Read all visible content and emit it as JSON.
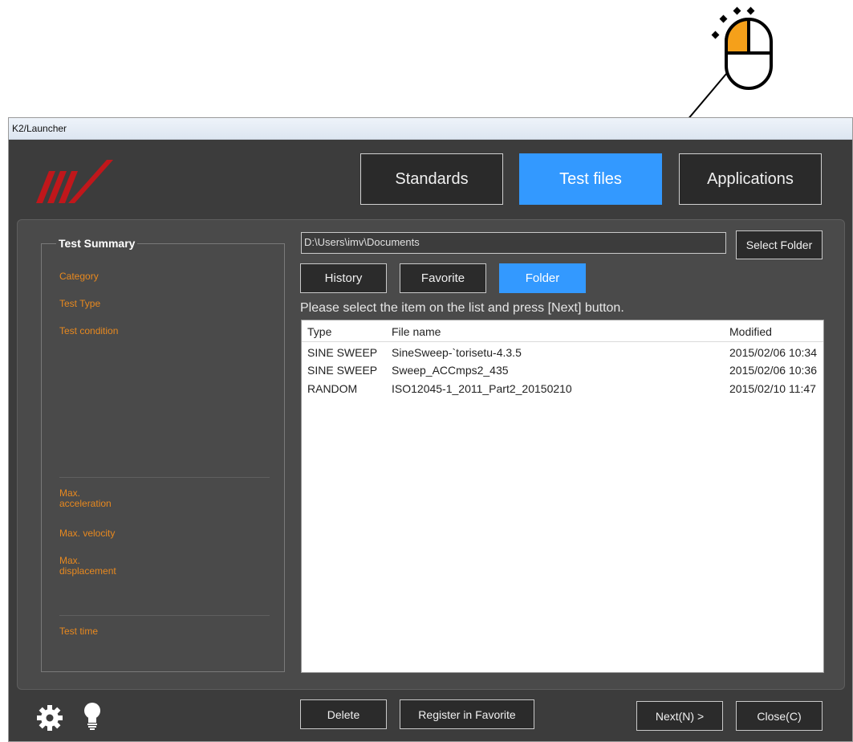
{
  "window": {
    "title": "K2/Launcher"
  },
  "top_tabs": [
    {
      "label": "Standards",
      "active": false
    },
    {
      "label": "Test files",
      "active": true
    },
    {
      "label": "Applications",
      "active": false
    }
  ],
  "summary": {
    "title": "Test Summary",
    "labels": {
      "category": "Category",
      "test_type": "Test Type",
      "test_condition": "Test condition",
      "max_acceleration": "Max.\nacceleration",
      "max_velocity": "Max. velocity",
      "max_displacement": "Max.\ndisplacement",
      "test_time": "Test time"
    }
  },
  "path": {
    "value": "D:\\Users\\imv\\Documents"
  },
  "select_folder_label": "Select Folder",
  "sub_tabs": [
    {
      "label": "History",
      "active": false
    },
    {
      "label": "Favorite",
      "active": false
    },
    {
      "label": "Folder",
      "active": true
    }
  ],
  "instruction": "Please select the item on the list and press [Next] button.",
  "file_list": {
    "columns": [
      "Type",
      "File name",
      "Modified"
    ],
    "rows": [
      [
        "SINE SWEEP",
        "SineSweep-`torisetu-4.3.5",
        "2015/02/06 10:34"
      ],
      [
        "SINE SWEEP",
        "Sweep_ACCmps2_435",
        "2015/02/06 10:36"
      ],
      [
        "RANDOM",
        "ISO12045-1_2011_Part2_20150210",
        "2015/02/10 11:47"
      ]
    ]
  },
  "bottom_buttons": {
    "delete": "Delete",
    "register": "Register in Favorite",
    "next": "Next(N) >",
    "close": "Close(C)"
  },
  "icons": {
    "settings": "gear-icon",
    "tips": "lightbulb-icon",
    "mouse": "mouse-left-click-icon"
  },
  "colors": {
    "accent": "#3399ff",
    "label_orange": "#e8891f",
    "background": "#3c3c3c"
  }
}
